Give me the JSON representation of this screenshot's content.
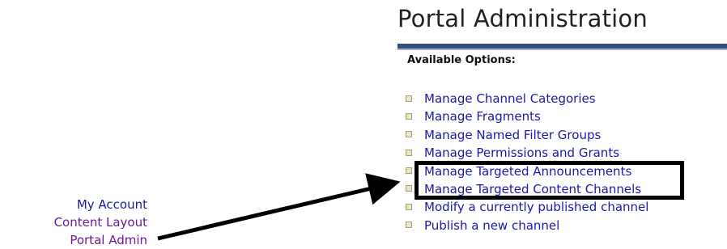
{
  "page": {
    "title": "Portal Administration",
    "available_label": "Available Options:"
  },
  "left_nav": {
    "items": [
      {
        "label": "My Account"
      },
      {
        "label": "Content Layout"
      },
      {
        "label": "Portal Admin"
      }
    ]
  },
  "options": [
    {
      "label": "Manage Channel Categories"
    },
    {
      "label": "Manage Fragments"
    },
    {
      "label": "Manage Named Filter Groups"
    },
    {
      "label": "Manage Permissions and Grants"
    },
    {
      "label": "Manage Targeted Announcements"
    },
    {
      "label": "Manage Targeted Content Channels"
    },
    {
      "label": "Modify a currently published channel"
    },
    {
      "label": "Publish a new channel"
    }
  ],
  "annotation": {
    "highlighted_option": "Manage Targeted Announcements",
    "arrow_from": "Portal Admin"
  },
  "colors": {
    "link": "#1a1aa8",
    "visited_link": "#6a1a9a",
    "title_rule": "#35507c",
    "annotation": "#000000"
  }
}
